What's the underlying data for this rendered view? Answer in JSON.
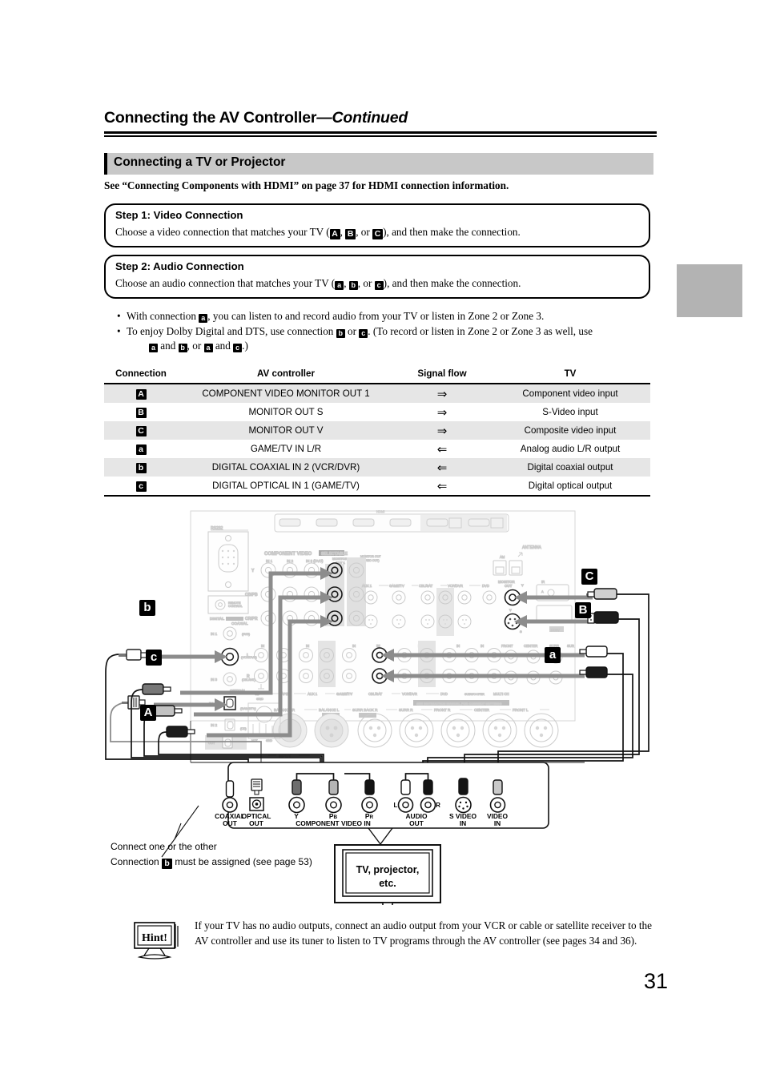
{
  "header": {
    "title_main": "Connecting the AV Controller",
    "title_cont": "—Continued"
  },
  "section": {
    "bar_title": "Connecting a TV or Projector",
    "see_note": "See “Connecting Components with HDMI” on page 37 for HDMI connection information."
  },
  "steps": [
    {
      "title": "Step 1: Video Connection",
      "desc_pre": "Choose a video connection that matches your TV (",
      "m1": "A",
      "sep1": ", ",
      "m2": "B",
      "sep2": ", or ",
      "m3": "C",
      "desc_post": "), and then make the connection."
    },
    {
      "title": "Step 2: Audio Connection",
      "desc_pre": "Choose an audio connection that matches your TV (",
      "m1": "a",
      "sep1": ", ",
      "m2": "b",
      "sep2": ", or ",
      "m3": "c",
      "desc_post": "), and then make the connection."
    }
  ],
  "bullets": {
    "b1_pre": "With connection ",
    "b1_mark": "a",
    "b1_post": ", you can listen to and record audio from your TV or listen in Zone 2 or Zone 3.",
    "b2_pre": "To enjoy Dolby Digital and DTS, use connection ",
    "b2_m1": "b",
    "b2_mid": " or ",
    "b2_m2": "c",
    "b2_post": ". (To record or listen in Zone 2 or Zone 3 as well, use",
    "b2l2_m1": "a",
    "b2l2_t1": " and ",
    "b2l2_m2": "b",
    "b2l2_t2": ", or ",
    "b2l2_m3": "a",
    "b2l2_t3": " and ",
    "b2l2_m4": "c",
    "b2l2_t4": ".)"
  },
  "table": {
    "headers": [
      "Connection",
      "AV controller",
      "Signal flow",
      "TV"
    ],
    "rows": [
      {
        "mark": "A",
        "controller": "COMPONENT VIDEO MONITOR OUT 1",
        "flow": "⇒",
        "tv": "Component video input",
        "alt": true
      },
      {
        "mark": "B",
        "controller": "MONITOR OUT S",
        "flow": "⇒",
        "tv": "S-Video input",
        "alt": false
      },
      {
        "mark": "C",
        "controller": "MONITOR OUT V",
        "flow": "⇒",
        "tv": "Composite video input",
        "alt": true
      },
      {
        "mark": "a",
        "controller": "GAME/TV IN L/R",
        "flow": "⇐",
        "tv": "Analog audio L/R output",
        "alt": false
      },
      {
        "mark": "b",
        "controller": "DIGITAL COAXIAL IN 2 (VCR/DVR)",
        "flow": "⇐",
        "tv": "Digital coaxial output",
        "alt": true
      },
      {
        "mark": "c",
        "controller": "DIGITAL OPTICAL IN 1 (GAME/TV)",
        "flow": "⇐",
        "tv": "Digital optical output",
        "alt": false
      }
    ]
  },
  "diagram": {
    "markers": {
      "A": "A",
      "B": "B",
      "C": "C",
      "a": "a",
      "b": "b",
      "c": "c"
    },
    "rear_panel_labels": {
      "rs232": "RS232",
      "component_video": "COMPONENT VIDEO",
      "component_in1": "IN 1",
      "component_in2": "IN 2",
      "component_in3": "IN 3 (DVD)",
      "monitor_out1": "MONITOR OUT 1",
      "y": "Y",
      "cbpb": "CB/PB",
      "crpr": "CR/PR",
      "digital": "DIGITAL",
      "coaxial": "COAXIAL",
      "optical": "OPTICAL",
      "coax_in1": "IN 1",
      "coax_in2": "IN 2",
      "coax_in3": "IN 3",
      "opt_in1": "IN 1",
      "opt_in2": "IN 2",
      "remote_control": "REMOTE CONTROL",
      "antenna": "ANTENNA",
      "am": "AM",
      "monitor_out": "MONITOR OUT",
      "aux1": "AUX 1",
      "gametv": "GAME/TV",
      "cblsat": "CBL/SAT",
      "vcrdvr": "VCR/DVR",
      "dvd": "DVD",
      "cd": "CD",
      "tape": "TAPE",
      "multich": "MULTI CH",
      "front": "FRONT",
      "center": "CENTER",
      "surr": "SURR",
      "in": "IN",
      "out": "OUT",
      "l": "L",
      "r": "R",
      "s": "S",
      "v": "V",
      "balance_r": "BALANCE R",
      "balance_l": "BALANCE L",
      "surr_back_r": "SURR BACK R",
      "surr_r": "SURR R",
      "front_r": "FRONT R",
      "front_l": "FRONT L",
      "input": "INPUT",
      "gnd": "GND",
      "notice": "SEE INSTRUCTION MANUAL FOR CORRECT SETTINGS"
    },
    "tv_panel": {
      "jacks": [
        {
          "l1": "COAXIAL",
          "l2": "OUT"
        },
        {
          "l1": "OPTICAL",
          "l2": "OUT"
        },
        {
          "l1": "Y",
          "l2": ""
        },
        {
          "l1": "Pʙ",
          "l2": ""
        },
        {
          "l1": "Pʀ",
          "l2": ""
        },
        {
          "l1": "AUDIO",
          "l2": "OUT"
        },
        {
          "l1": "S VIDEO",
          "l2": "IN"
        },
        {
          "l1": "VIDEO",
          "l2": "IN"
        }
      ],
      "component_group": "COMPONENT VIDEO IN",
      "audio_l": "L",
      "audio_r": "R"
    },
    "tv_box": {
      "line1": "TV, projector,",
      "line2": "etc."
    }
  },
  "notes": {
    "line1": "Connect one or the other",
    "line2_pre": "Connection ",
    "line2_mark": "b",
    "line2_post": " must be assigned (see page 53)"
  },
  "hint": {
    "label": "Hint!",
    "text": "If your TV has no audio outputs, connect an audio output from your VCR or cable or satellite receiver to the AV controller and use its tuner to listen to TV programs through the AV controller (see pages 34 and 36)."
  },
  "page_number": "31",
  "colors": {
    "section_bar": "#c8c8c8",
    "table_alt_row": "#e6e6e6",
    "tab": "#b3b3b3",
    "cable_gray": "#808080",
    "panel_light": "#d8d8d8"
  }
}
